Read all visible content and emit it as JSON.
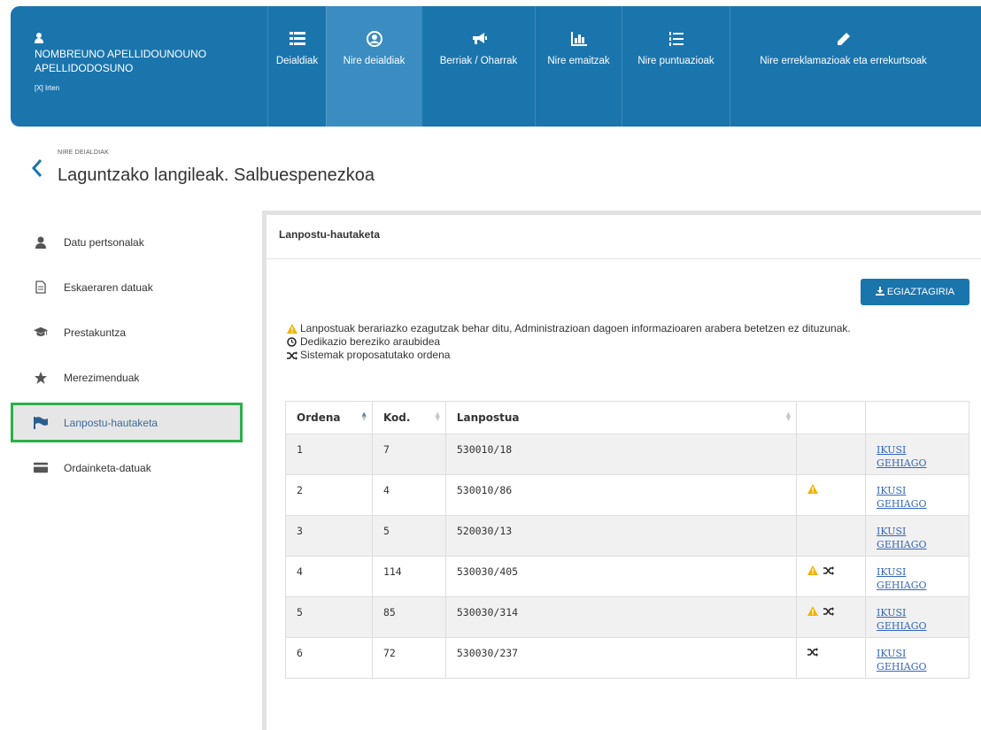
{
  "user": {
    "name": "NOMBREUNO APELLIDOUNOUNO APELLIDODOSUNO",
    "exit_label": "[X] Irten"
  },
  "nav": {
    "items": [
      {
        "label": "Deialdiak",
        "icon": "list-icon"
      },
      {
        "label": "Nire deialdiak",
        "icon": "user-circle-icon"
      },
      {
        "label": "Berriak / Oharrak",
        "icon": "bullhorn-icon"
      },
      {
        "label": "Nire emaitzak",
        "icon": "bar-chart-icon"
      },
      {
        "label": "Nire puntuazioak",
        "icon": "list-ordered-icon"
      },
      {
        "label": "Nire erreklamazioak eta errekurtsoak",
        "icon": "pencil-icon"
      }
    ],
    "active_index": 1
  },
  "breadcrumb": "NIRE DEIALDIAK",
  "page_title": "Laguntzako langileak. Salbuespenezkoa",
  "sidebar": {
    "items": [
      {
        "label": "Datu pertsonalak",
        "icon": "user-icon"
      },
      {
        "label": "Eskaeraren datuak",
        "icon": "document-icon"
      },
      {
        "label": "Prestakuntza",
        "icon": "graduation-cap-icon"
      },
      {
        "label": "Merezimenduak",
        "icon": "star-icon"
      },
      {
        "label": "Lanpostu-hautaketa",
        "icon": "flag-icon"
      },
      {
        "label": "Ordainketa-datuak",
        "icon": "credit-card-icon"
      }
    ],
    "active_index": 4
  },
  "panel": {
    "title": "Lanpostu-hautaketa",
    "cert_button": "EGIAZTAGIRIA",
    "legend": {
      "warning": "Lanpostuak berariazko ezagutzak behar ditu, Administrazioan dagoen informazioaren arabera betetzen ez dituzunak.",
      "dedication": "Dedikazio bereziko araubidea",
      "system_order": "Sistemak proposatutako ordena"
    },
    "table": {
      "headers": {
        "order": "Ordena",
        "code": "Kod.",
        "post": "Lanpostua"
      },
      "more_label": "IKUSI GEHIAGO",
      "rows": [
        {
          "order": "1",
          "code": "7",
          "post": "530010/18",
          "warning": false,
          "shuffle": false
        },
        {
          "order": "2",
          "code": "4",
          "post": "530010/86",
          "warning": true,
          "shuffle": false
        },
        {
          "order": "3",
          "code": "5",
          "post": "520030/13",
          "warning": false,
          "shuffle": false
        },
        {
          "order": "4",
          "code": "114",
          "post": "530030/405",
          "warning": true,
          "shuffle": true
        },
        {
          "order": "5",
          "code": "85",
          "post": "530030/314",
          "warning": true,
          "shuffle": true
        },
        {
          "order": "6",
          "code": "72",
          "post": "530030/237",
          "warning": false,
          "shuffle": true
        }
      ]
    }
  },
  "colors": {
    "brand": "#1b75ad",
    "active_nav": "#3a8cc1",
    "warning": "#f0b400",
    "highlight": "#2bb04a",
    "link": "#3366bb"
  }
}
